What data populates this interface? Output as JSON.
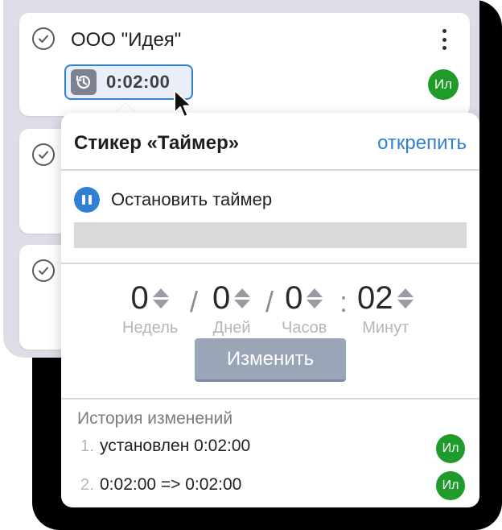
{
  "task": {
    "title": "ООО \"Идея\"",
    "timer_value": "0:02:00",
    "assignee_initials": "Ил"
  },
  "popover": {
    "title": "Стикер «Таймер»",
    "unpin_label": "открепить",
    "stop_label": "Остановить таймер",
    "units": [
      {
        "value": "0",
        "label": "Недель"
      },
      {
        "value": "0",
        "label": "Дней"
      },
      {
        "value": "0",
        "label": "Часов"
      },
      {
        "value": "02",
        "label": "Минут"
      }
    ],
    "separators": [
      "/",
      "/",
      ":"
    ],
    "change_label": "Изменить",
    "history_title": "История изменений",
    "history": [
      {
        "num": "1.",
        "text": "установлен 0:02:00",
        "initials": "Ил"
      },
      {
        "num": "2.",
        "text": "0:02:00 => 0:02:00",
        "initials": "Ил"
      }
    ]
  },
  "colors": {
    "accent": "#2f7fd4",
    "avatar": "#1f9b2a",
    "button": "#9aa5b8"
  }
}
